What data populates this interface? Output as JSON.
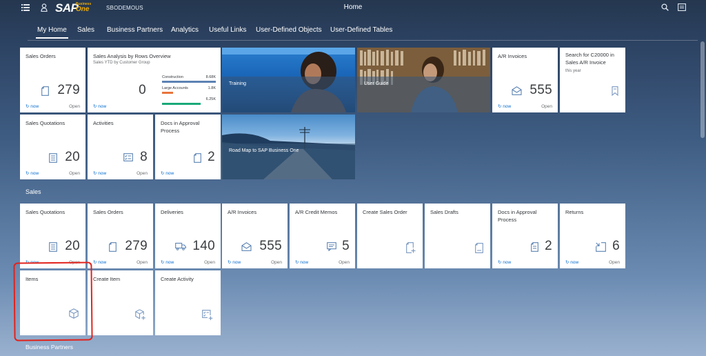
{
  "header": {
    "menu_icon": "menu-icon",
    "user_icon": "user-icon",
    "logo_text": "SAP",
    "logo_business": "Business",
    "logo_one": "One",
    "company": "SBODEMOUS",
    "title": "Home",
    "search_icon": "search-icon",
    "notifications_icon": "notification-icon"
  },
  "tabs": [
    "My Home",
    "Sales",
    "Business Partners",
    "Analytics",
    "Useful Links",
    "User-Defined Objects",
    "User-Defined Tables"
  ],
  "row1": {
    "sales_orders": {
      "title": "Sales Orders",
      "value": "279",
      "refresh": "now",
      "status": "Open"
    },
    "sales_analysis": {
      "title": "Sales Analysis by Rows Overview",
      "subtitle": "Sales YTD by Customer Group",
      "value": "0",
      "refresh": "now",
      "bars": [
        {
          "label": "Construction",
          "value": "8.68K",
          "fraction": 1.0,
          "color": "#5b82b3"
        },
        {
          "label": "Large Accounts",
          "value": "1.8K",
          "fraction": 0.2,
          "color": "#e8743b"
        },
        {
          "label": "",
          "value": "6.25K",
          "fraction": 0.72,
          "color": "#19a979"
        }
      ]
    },
    "training": {
      "caption": "Training"
    },
    "user_guide": {
      "caption": "User Guide"
    },
    "ar_invoices": {
      "title": "A/R Invoices",
      "value": "555",
      "refresh": "now",
      "status": "Open"
    },
    "search_tile": {
      "title": "Search for C20000 in Sales A/R Invoice",
      "subtitle": "this year"
    }
  },
  "row2": {
    "sales_quotations": {
      "title": "Sales Quotations",
      "value": "20",
      "refresh": "now",
      "status": "Open"
    },
    "activities": {
      "title": "Activities",
      "value": "8",
      "refresh": "now",
      "status": "Open"
    },
    "docs_approval": {
      "title": "Docs in Approval Process",
      "value": "2",
      "refresh": "now"
    },
    "roadmap": {
      "caption": "Road Map to SAP Business One"
    }
  },
  "sales_section": {
    "heading": "Sales",
    "tiles": [
      {
        "title": "Sales Quotations",
        "value": "20",
        "refresh": "now",
        "status": "Open",
        "icon": "quotation-icon"
      },
      {
        "title": "Sales Orders",
        "value": "279",
        "refresh": "now",
        "status": "Open",
        "icon": "order-icon"
      },
      {
        "title": "Deliveries",
        "value": "140",
        "refresh": "now",
        "status": "Open",
        "icon": "truck-icon"
      },
      {
        "title": "A/R Invoices",
        "value": "555",
        "refresh": "now",
        "status": "Open",
        "icon": "invoice-icon"
      },
      {
        "title": "A/R Credit Memos",
        "value": "5",
        "refresh": "now",
        "status": "Open",
        "icon": "memo-icon"
      },
      {
        "title": "Create Sales Order",
        "icon": "create-document-icon"
      },
      {
        "title": "Sales Drafts",
        "icon": "draft-icon"
      },
      {
        "title": "Docs in Approval Process",
        "value": "2",
        "refresh": "now",
        "icon": "document-icon"
      },
      {
        "title": "Returns",
        "value": "6",
        "refresh": "now",
        "status": "Open",
        "icon": "return-icon"
      }
    ],
    "row2": [
      {
        "title": "Items",
        "icon": "cube-icon"
      },
      {
        "title": "Create Item",
        "icon": "create-item-icon"
      },
      {
        "title": "Create Activity",
        "icon": "create-activity-icon"
      }
    ]
  },
  "bp_section": {
    "heading": "Business Partners"
  },
  "colors": {
    "accent": "#0a6ed1",
    "highlight": "#e2221b",
    "header_bg": "#25374f"
  }
}
